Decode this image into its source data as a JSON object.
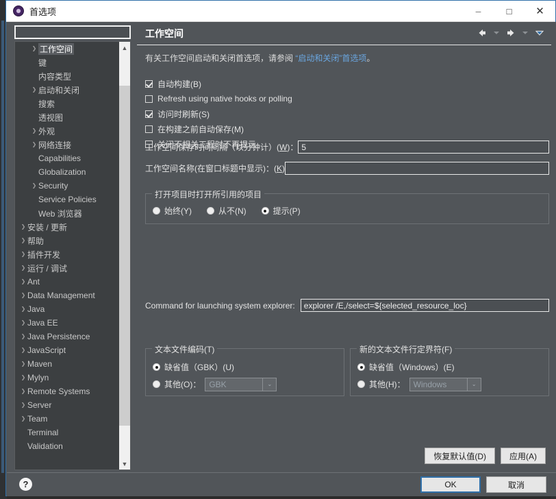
{
  "window": {
    "title": "首选项",
    "app_icon": "eclipse-icon",
    "minimize": "–",
    "maximize": "□",
    "close": "✕"
  },
  "sidebar": {
    "search": {
      "value": "",
      "placeholder": ""
    },
    "scroll_up": "▲",
    "scroll_down": "▼",
    "items": [
      {
        "label": "工作空间",
        "level": 2,
        "arrow": true,
        "selected": true
      },
      {
        "label": "键",
        "level": 2,
        "arrow": false,
        "selected": false
      },
      {
        "label": "内容类型",
        "level": 2,
        "arrow": false,
        "selected": false
      },
      {
        "label": "启动和关闭",
        "level": 2,
        "arrow": true,
        "selected": false
      },
      {
        "label": "搜索",
        "level": 2,
        "arrow": false,
        "selected": false
      },
      {
        "label": "透视图",
        "level": 2,
        "arrow": false,
        "selected": false
      },
      {
        "label": "外观",
        "level": 2,
        "arrow": true,
        "selected": false
      },
      {
        "label": "网络连接",
        "level": 2,
        "arrow": true,
        "selected": false
      },
      {
        "label": "Capabilities",
        "level": 2,
        "arrow": false,
        "selected": false
      },
      {
        "label": "Globalization",
        "level": 2,
        "arrow": false,
        "selected": false
      },
      {
        "label": "Security",
        "level": 2,
        "arrow": true,
        "selected": false
      },
      {
        "label": "Service Policies",
        "level": 2,
        "arrow": false,
        "selected": false
      },
      {
        "label": "Web 浏览器",
        "level": 2,
        "arrow": false,
        "selected": false
      },
      {
        "label": "安装 / 更新",
        "level": 1,
        "arrow": true,
        "selected": false
      },
      {
        "label": "帮助",
        "level": 1,
        "arrow": true,
        "selected": false
      },
      {
        "label": "插件开发",
        "level": 1,
        "arrow": true,
        "selected": false
      },
      {
        "label": "运行 / 调试",
        "level": 1,
        "arrow": true,
        "selected": false
      },
      {
        "label": "Ant",
        "level": 1,
        "arrow": true,
        "selected": false
      },
      {
        "label": "Data Management",
        "level": 1,
        "arrow": true,
        "selected": false
      },
      {
        "label": "Java",
        "level": 1,
        "arrow": true,
        "selected": false
      },
      {
        "label": "Java EE",
        "level": 1,
        "arrow": true,
        "selected": false
      },
      {
        "label": "Java Persistence",
        "level": 1,
        "arrow": true,
        "selected": false
      },
      {
        "label": "JavaScript",
        "level": 1,
        "arrow": true,
        "selected": false
      },
      {
        "label": "Maven",
        "level": 1,
        "arrow": true,
        "selected": false
      },
      {
        "label": "Mylyn",
        "level": 1,
        "arrow": true,
        "selected": false
      },
      {
        "label": "Remote Systems",
        "level": 1,
        "arrow": true,
        "selected": false
      },
      {
        "label": "Server",
        "level": 1,
        "arrow": true,
        "selected": false
      },
      {
        "label": "Team",
        "level": 1,
        "arrow": true,
        "selected": false
      },
      {
        "label": "Terminal",
        "level": 1,
        "arrow": false,
        "selected": false
      },
      {
        "label": "Validation",
        "level": 1,
        "arrow": false,
        "selected": false
      }
    ]
  },
  "page": {
    "title": "工作空间",
    "description_before": "有关工作空间启动和关闭首选项，请参阅 ",
    "description_link": "“启动和关闭”首选项",
    "description_after": "。",
    "checkboxes": [
      {
        "label": "自动构建(B)",
        "checked": true
      },
      {
        "label": "Refresh using native hooks or polling",
        "checked": false
      },
      {
        "label": "访问时刷新(S)",
        "checked": true
      },
      {
        "label": "在构建之前自动保存(M)",
        "checked": false
      },
      {
        "label": "关闭不相关工程时不再提示",
        "checked": false
      }
    ],
    "fields": [
      {
        "label_pre": "工作空间保存时间间隔（以分钟计）(",
        "mnemonic": "W",
        "label_post": ")：",
        "value": "5"
      },
      {
        "label_pre": "工作空间名称(在窗口标题中显示)：(",
        "mnemonic": "K",
        "label_post": ")",
        "value": ""
      }
    ],
    "referenced_group": {
      "legend": "打开项目时打开所引用的项目",
      "options": [
        {
          "label": "始终(Y)",
          "selected": false
        },
        {
          "label": "从不(N)",
          "selected": false
        },
        {
          "label": "提示(P)",
          "selected": true
        }
      ]
    },
    "command_row": {
      "label": "Command for launching system explorer:",
      "value": "explorer /E,/select=${selected_resource_loc}"
    },
    "encoding_group": {
      "legend": "文本文件编码(T)",
      "default_option": {
        "label": "缺省值（GBK）(U)",
        "selected": true
      },
      "other_option": {
        "label": "其他(O)：",
        "selected": false
      },
      "other_value": "GBK",
      "dropdown_arrow": "⌄"
    },
    "delimiter_group": {
      "legend": "新的文本文件行定界符(F)",
      "default_option": {
        "label": "缺省值（Windows）(E)",
        "selected": true
      },
      "other_option": {
        "label": "其他(H)：",
        "selected": false
      },
      "other_value": "Windows",
      "dropdown_arrow": "⌄"
    },
    "restore_defaults": "恢复默认值(D)",
    "apply": "应用(A)",
    "nav": {
      "back": "back-arrow",
      "forward": "forward-arrow",
      "menu": "view-menu"
    }
  },
  "footer": {
    "help": "?",
    "ok": "OK",
    "cancel": "取消"
  },
  "colors": {
    "dialog_bg": "#515559",
    "tree_bg": "#3c3f41",
    "accent_border": "#2f6fa8",
    "link": "#6aa6e0",
    "text": "#e2e2e2"
  }
}
